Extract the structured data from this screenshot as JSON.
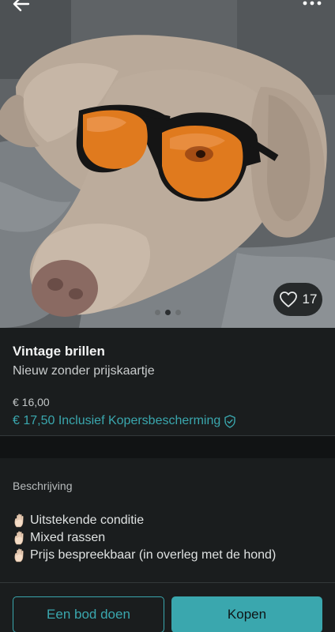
{
  "gallery": {
    "like_count": "17",
    "photo_count": 3,
    "active_photo_index": 1
  },
  "product": {
    "title": "Vintage brillen",
    "condition": "Nieuw zonder prijskaartje",
    "price": "€ 16,00",
    "price_with_protection": "€ 17,50 Inclusief Kopersbescherming"
  },
  "description": {
    "heading": "Beschrijving",
    "lines": [
      "Uitstekende conditie",
      "Mixed rassen",
      "Prijs bespreekbaar (in overleg met de hond)"
    ]
  },
  "actions": {
    "offer_label": "Een bod doen",
    "buy_label": "Kopen"
  },
  "colors": {
    "accent": "#3aa7ae",
    "background": "#1a1d1e",
    "lens": "#e07a1e"
  },
  "icons": {
    "back": "arrow-left-icon",
    "more": "more-horizontal-icon",
    "like": "heart-icon",
    "protection": "shield-check-icon",
    "bullet": "raised-hand-emoji"
  }
}
